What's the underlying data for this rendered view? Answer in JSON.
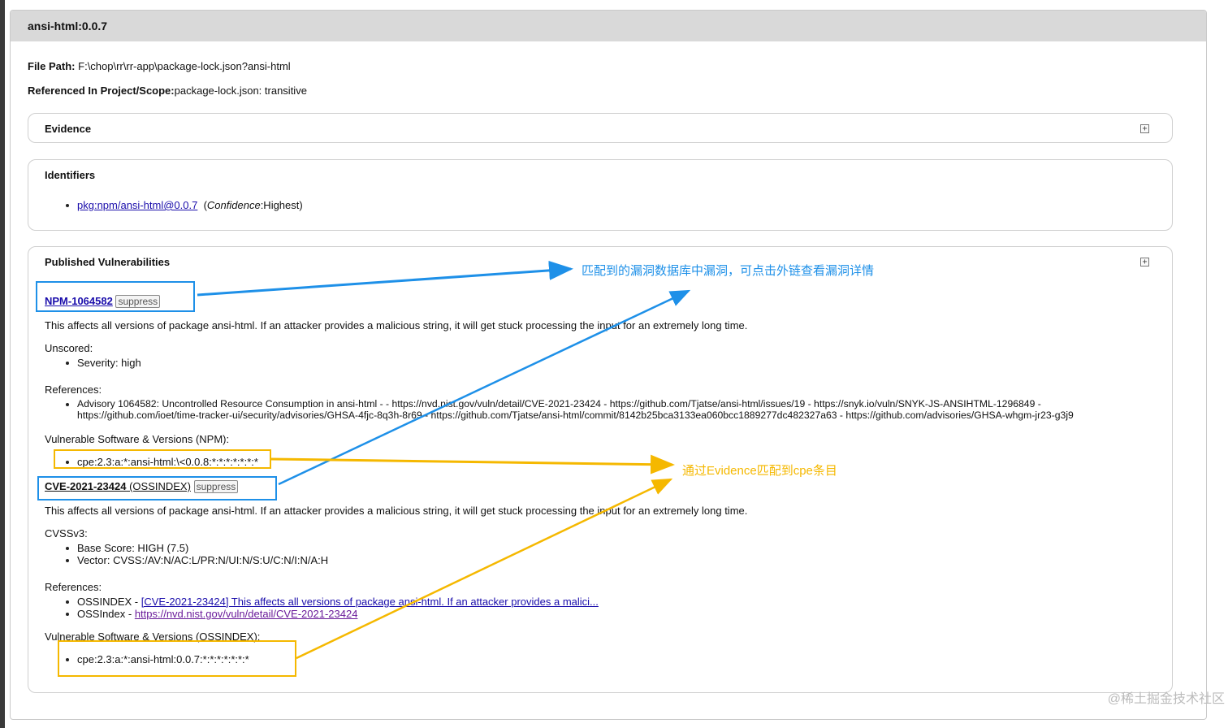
{
  "card": {
    "title": "ansi-html:0.0.7",
    "file_path_label": "File Path:",
    "file_path_value": "F:\\chop\\rr\\rr-app\\package-lock.json?ansi-html",
    "referenced_label": "Referenced In Project/Scope:",
    "referenced_value": "package-lock.json: transitive"
  },
  "evidence": {
    "title": "Evidence"
  },
  "identifiers": {
    "title": "Identifiers",
    "item_link": "pkg:npm/ansi-html@0.0.7",
    "confidence_label": "Confidence",
    "confidence_value": ":Highest)",
    "open_paren": "("
  },
  "vulns": {
    "title": "Published Vulnerabilities",
    "npm": {
      "id": "NPM-1064582",
      "suppress": "suppress",
      "description": "This affects all versions of package ansi-html. If an attacker provides a malicious string, it will get stuck processing the input for an extremely long time.",
      "unscored_label": "Unscored:",
      "severity": "Severity: high",
      "references_label": "References:",
      "reference_line1": "Advisory 1064582: Uncontrolled Resource Consumption in ansi-html - - https://nvd.nist.gov/vuln/detail/CVE-2021-23424 - https://github.com/Tjatse/ansi-html/issues/19 - https://snyk.io/vuln/SNYK-JS-ANSIHTML-1296849 -",
      "reference_line2": "https://github.com/ioet/time-tracker-ui/security/advisories/GHSA-4fjc-8q3h-8r69 - https://github.com/Tjatse/ansi-html/commit/8142b25bca3133ea060bcc1889277dc482327a63 - https://github.com/advisories/GHSA-whgm-jr23-g3j9",
      "vuln_software_label": "Vulnerable Software & Versions (NPM):",
      "cpe": "cpe:2.3:a:*:ansi-html:\\<0.0.8:*:*:*:*:*:*:*"
    },
    "cve": {
      "id": "CVE-2021-23424",
      "source": " (OSSINDEX)",
      "suppress": "suppress",
      "description": "This affects all versions of package ansi-html. If an attacker provides a malicious string, it will get stuck processing the input for an extremely long time.",
      "cvss_label": "CVSSv3:",
      "base_score": "Base Score: HIGH (7.5)",
      "vector": "Vector: CVSS:/AV:N/AC:L/PR:N/UI:N/S:U/C:N/I:N/A:H",
      "references_label": "References:",
      "ref1_prefix": "OSSINDEX - ",
      "ref1_link": "[CVE-2021-23424] This affects all versions of package ansi-html. If an attacker provides a malici...",
      "ref2_prefix": "OSSIndex - ",
      "ref2_link": "https://nvd.nist.gov/vuln/detail/CVE-2021-23424",
      "vuln_software_label": "Vulnerable Software & Versions (OSSINDEX):",
      "cpe": "cpe:2.3:a:*:ansi-html:0.0.7:*:*:*:*:*:*:*"
    }
  },
  "annotations": {
    "blue_text": "匹配到的漏洞数据库中漏洞，可点击外链查看漏洞详情",
    "orange_text": "通过Evidence匹配到cpe条目",
    "blue_color": "#1e90e8",
    "orange_color": "#f5b800"
  },
  "watermark": "@稀土掘金技术社区"
}
